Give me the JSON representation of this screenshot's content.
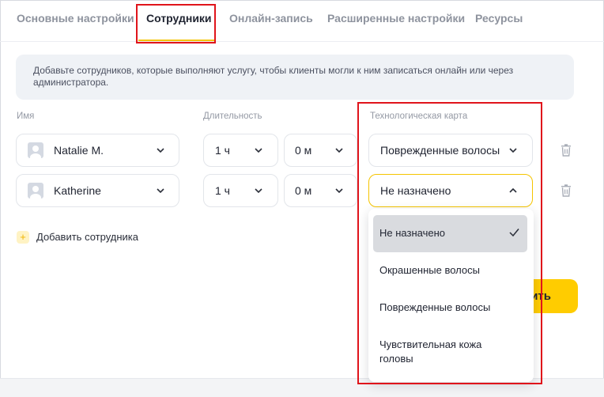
{
  "tabs": [
    {
      "label": "Основные настройки"
    },
    {
      "label": "Сотрудники"
    },
    {
      "label": "Онлайн-запись"
    },
    {
      "label": "Расширенные настройки"
    },
    {
      "label": "Ресурсы"
    }
  ],
  "active_tab": "Сотрудники",
  "info_text": "Добавьте сотрудников, которые выполняют услугу, чтобы клиенты могли к ним записаться онлайн или через администратора.",
  "columns": {
    "name": "Имя",
    "duration": "Длительность",
    "tech_card": "Технологическая карта"
  },
  "employees": [
    {
      "name": "Natalie M.",
      "hours": "1 ч",
      "minutes": "0 м",
      "tech_card": "Поврежденные волосы"
    },
    {
      "name": "Katherine",
      "hours": "1 ч",
      "minutes": "0 м",
      "tech_card": "Не назначено"
    }
  ],
  "add_employee": {
    "label": "Добавить сотрудника",
    "icon": "plus-icon"
  },
  "save_button": {
    "label": "ить"
  },
  "tech_card_dropdown": {
    "selected": "Не назначено",
    "options": [
      "Не назначено",
      "Окрашенные волосы",
      "Поврежденные волосы",
      "Чувствительная кожа головы"
    ]
  },
  "colors": {
    "accent": "#ffcc00",
    "highlight": "#e0141b",
    "muted": "#9499a4"
  }
}
